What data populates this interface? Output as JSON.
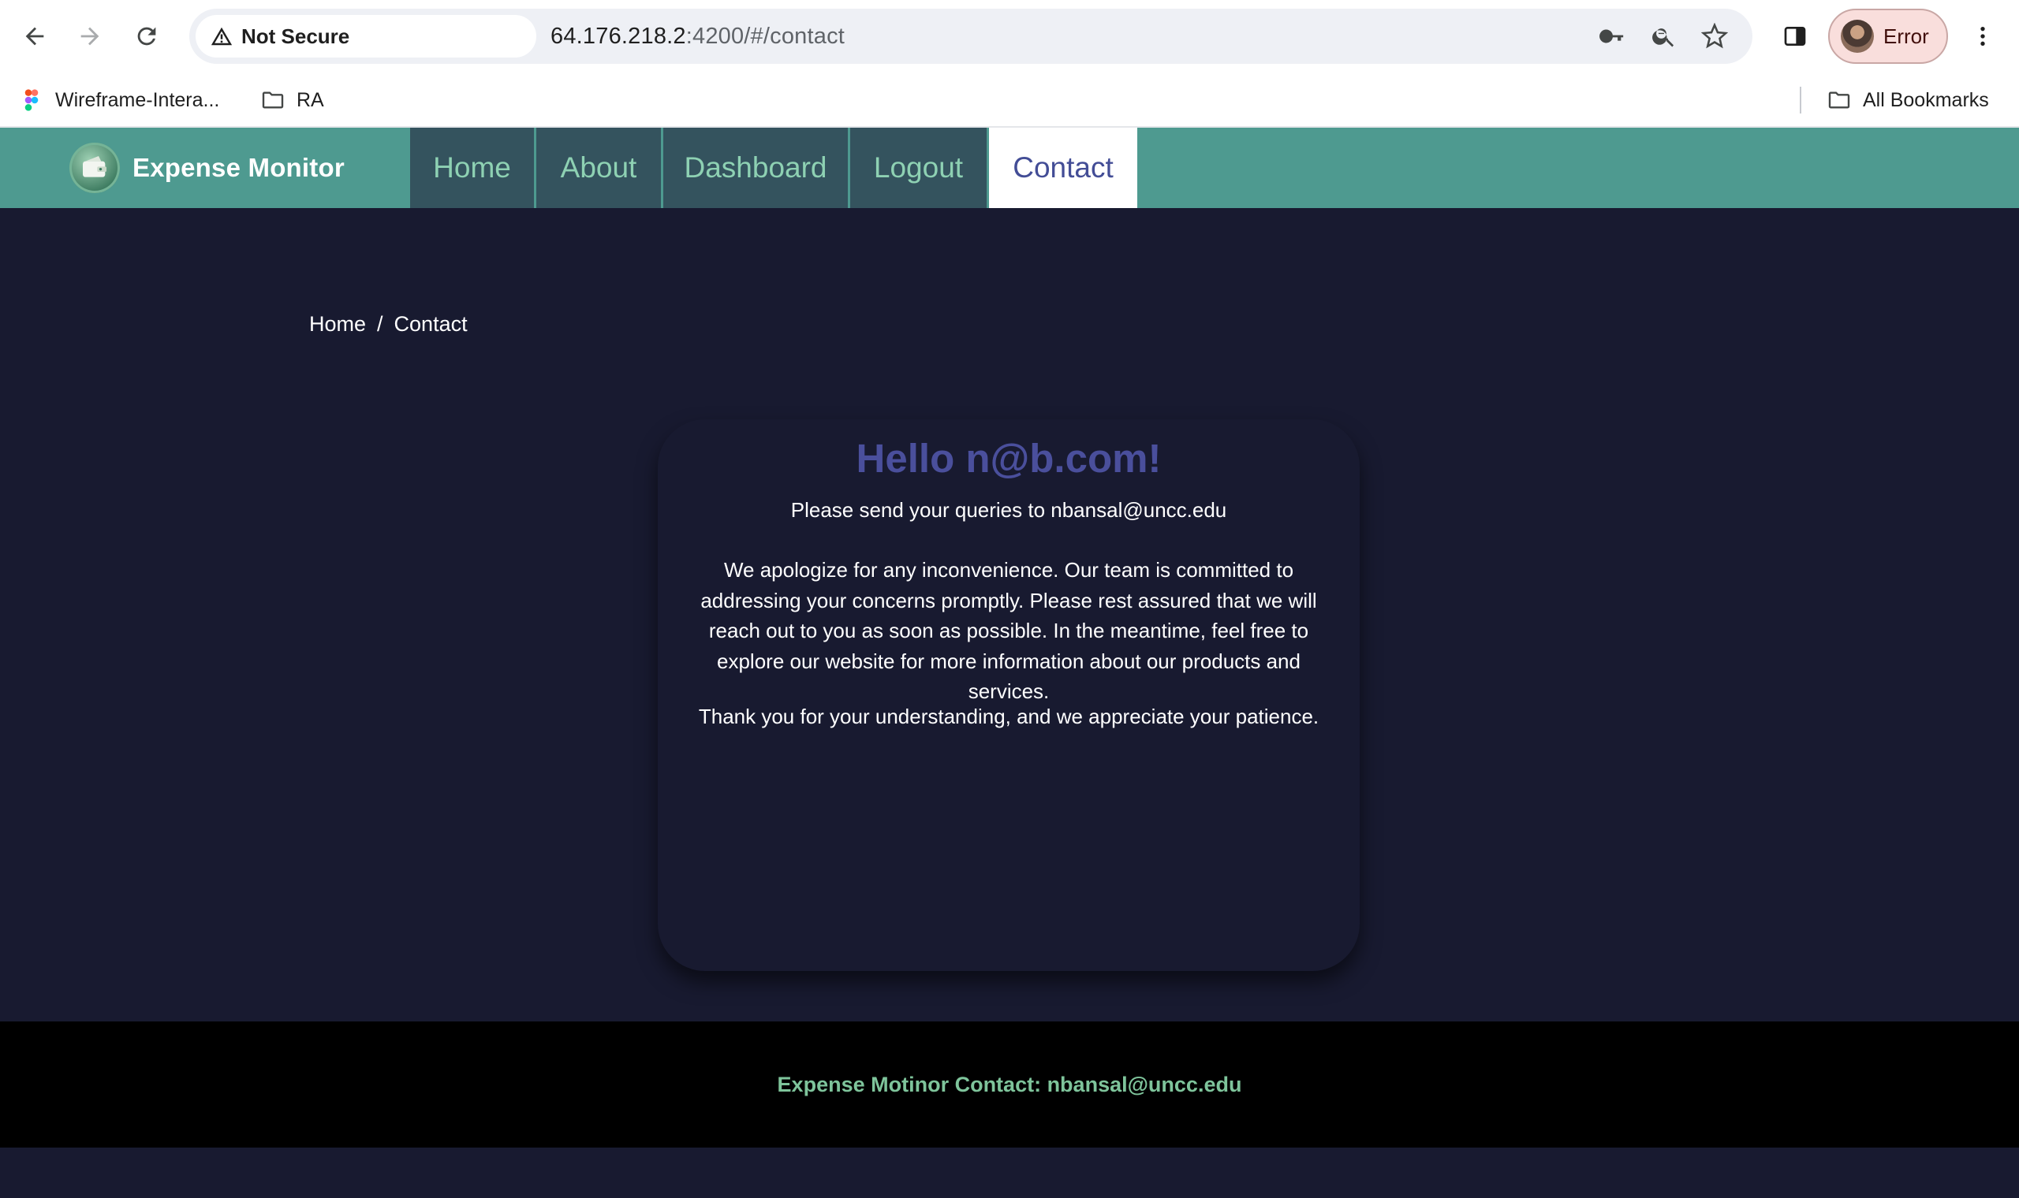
{
  "browser": {
    "security_label": "Not Secure",
    "url_host": "64.176.218.2",
    "url_path": ":4200/#/contact",
    "profile_label": "Error",
    "bookmarks": [
      {
        "label": "Wireframe-Intera..."
      },
      {
        "label": "RA"
      }
    ],
    "all_bookmarks_label": "All Bookmarks"
  },
  "app": {
    "brand": "Expense Monitor",
    "nav": [
      {
        "label": "Home"
      },
      {
        "label": "About"
      },
      {
        "label": "Dashboard"
      },
      {
        "label": "Logout"
      },
      {
        "label": "Contact"
      }
    ],
    "active_nav": "Contact"
  },
  "breadcrumb": {
    "home": "Home",
    "separator": "/",
    "current": "Contact"
  },
  "card": {
    "title": "Hello n@b.com!",
    "subtitle": "Please send your queries to nbansal@uncc.edu",
    "body": "We apologize for any inconvenience. Our team is committed to addressing your concerns promptly. Please rest assured that we will reach out to you as soon as possible. In the meantime, feel free to explore our website for more information about our products and services.",
    "thanks": "Thank you for your understanding, and we appreciate your patience."
  },
  "footer": {
    "text": "Expense Motinor Contact: nbansal@uncc.edu"
  },
  "colors": {
    "navbar": "#4e9a90",
    "nav_tab": "#34535e",
    "nav_tab_text": "#8ed1b3",
    "active_tab_text": "#434d96",
    "page_bg": "#181a30",
    "title": "#4a4f9c",
    "footer_text": "#7ec49b"
  }
}
